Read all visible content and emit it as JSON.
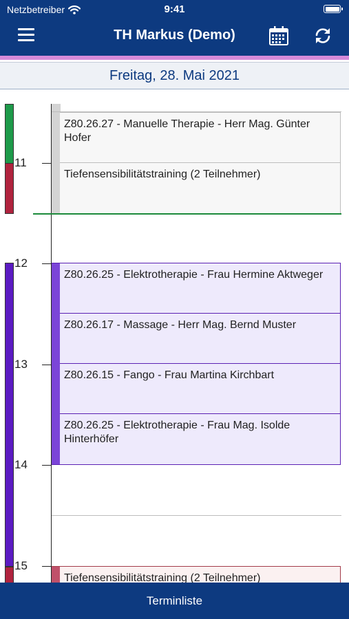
{
  "status_bar": {
    "carrier": "Netzbetreiber",
    "time": "9:41"
  },
  "header": {
    "title": "TH Markus (Demo)"
  },
  "icons": {
    "menu": "menu-icon",
    "calendar": "calendar-icon",
    "refresh": "refresh-icon",
    "wifi": "wifi-icon",
    "battery": "battery-icon"
  },
  "date_bar": {
    "label": "Freitag, 28. Mai 2021"
  },
  "schedule": {
    "hours": [
      "11",
      "12",
      "13",
      "14",
      "15"
    ],
    "appointments": [
      {
        "text": "Z80.26.27 - Manuelle Therapie - Herr Mag. Günter Hofer",
        "color": "gray"
      },
      {
        "text": "Tiefensensibilitätstraining (2 Teilnehmer)",
        "color": "gray"
      },
      {
        "text": "Z80.26.25 - Elektrotherapie - Frau Hermine Aktweger",
        "color": "purple"
      },
      {
        "text": "Z80.26.17 - Massage - Herr Mag. Bernd Muster",
        "color": "purple"
      },
      {
        "text": "Z80.26.15 - Fango - Frau Martina Kirchbart",
        "color": "purple"
      },
      {
        "text": "Z80.26.25 - Elektrotherapie - Frau Mag. Isolde Hinterhöfer",
        "color": "purple"
      },
      {
        "text": "Tiefensensibilitätstraining (2 Teilnehmer)",
        "color": "pink"
      }
    ]
  },
  "colors": {
    "header": "#0d3a80",
    "accent": "#d58ad9",
    "green": "#1e9a4a",
    "red": "#b0233e",
    "purple": "#5b1bc2"
  },
  "bottom_bar": {
    "label": "Terminliste"
  }
}
